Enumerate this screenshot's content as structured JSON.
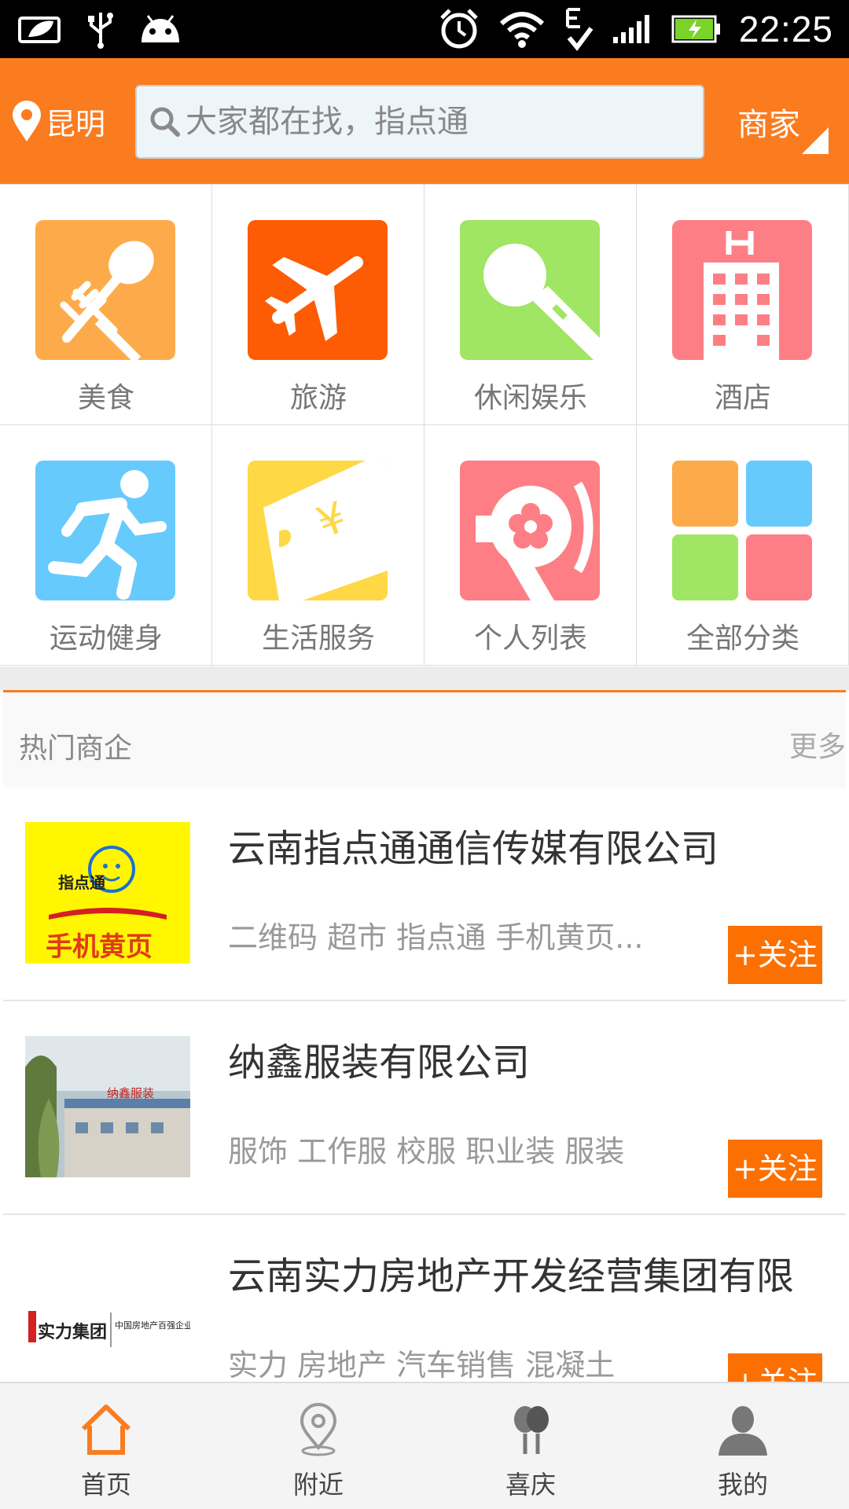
{
  "status_bar": {
    "time": "22:25",
    "icons": [
      "leaf-notification-icon",
      "usb-icon",
      "android-icon",
      "alarm-icon",
      "wifi-icon",
      "edge-signal-icon",
      "cell-signal-icon",
      "battery-charging-icon"
    ]
  },
  "header": {
    "city": "昆明",
    "search_placeholder": "大家都在找，指点通",
    "merchant_label": "商家"
  },
  "categories": [
    {
      "label": "美食",
      "icon": "food-icon",
      "color": "#fdab4a"
    },
    {
      "label": "旅游",
      "icon": "airplane-icon",
      "color": "#fd5c04"
    },
    {
      "label": "休闲娱乐",
      "icon": "microphone-icon",
      "color": "#a0e563"
    },
    {
      "label": "酒店",
      "icon": "hotel-icon",
      "color": "#fd7f85"
    },
    {
      "label": "运动健身",
      "icon": "runner-icon",
      "color": "#67cafc"
    },
    {
      "label": "生活服务",
      "icon": "ticket-icon",
      "color": "#fed845"
    },
    {
      "label": "个人列表",
      "icon": "profile-flower-icon",
      "color": "#fd7f85"
    },
    {
      "label": "全部分类",
      "icon": "all-categories-icon",
      "color": "#fdab4a"
    }
  ],
  "hot": {
    "title": "热门商企",
    "more": "更多",
    "follow_label": "+关注",
    "companies": [
      {
        "name": "云南指点通通信传媒有限公司",
        "tags": "二维码 超市 指点通 手机黄页...",
        "logo_text": "指点通",
        "logo_caption": "手机黄页"
      },
      {
        "name": "纳鑫服装有限公司",
        "tags": "服饰 工作服 校服 职业装 服装",
        "logo_text": "纳鑫服装"
      },
      {
        "name": "云南实力房地产开发经营集团有限",
        "tags": "实力 房地产 汽车销售 混凝土",
        "logo_text": "实力集团",
        "logo_caption": "中国房地产百强企业"
      }
    ]
  },
  "bottom_nav": [
    {
      "label": "首页",
      "icon": "home-icon",
      "active": true
    },
    {
      "label": "附近",
      "icon": "location-pin-icon"
    },
    {
      "label": "喜庆",
      "icon": "balloons-icon"
    },
    {
      "label": "我的",
      "icon": "user-icon"
    }
  ],
  "colors": {
    "brand": "#fb7b1f",
    "follow": "#fb7000"
  }
}
